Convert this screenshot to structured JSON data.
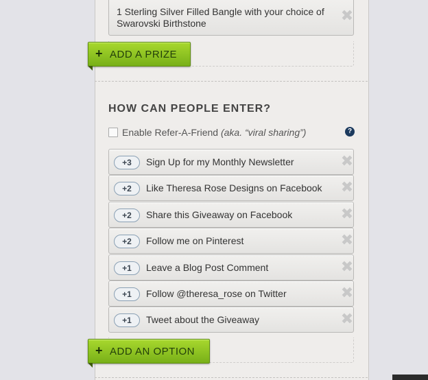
{
  "prize": {
    "text": "1 Sterling Silver Filled Bangle with your choice of Swarovski Birthstone",
    "remove_glyph": "✖"
  },
  "add_prize_button": {
    "plus": "+",
    "label": "Add a Prize"
  },
  "entry_section": {
    "heading": "How can people enter?",
    "refer_label": "Enable Refer-A-Friend",
    "refer_note": "(aka. “viral sharing”)",
    "help_glyph": "?"
  },
  "options": [
    {
      "points": "+3",
      "label": "Sign Up for my Monthly Newsletter",
      "remove_glyph": "✖"
    },
    {
      "points": "+2",
      "label": "Like Theresa Rose Designs on Facebook",
      "remove_glyph": "✖"
    },
    {
      "points": "+2",
      "label": "Share this Giveaway on Facebook",
      "remove_glyph": "✖"
    },
    {
      "points": "+2",
      "label": "Follow me on Pinterest",
      "remove_glyph": "✖"
    },
    {
      "points": "+1",
      "label": "Leave a Blog Post Comment",
      "remove_glyph": "✖"
    },
    {
      "points": "+1",
      "label": "Follow @theresa_rose on Twitter",
      "remove_glyph": "✖"
    },
    {
      "points": "+1",
      "label": "Tweet about the Giveaway",
      "remove_glyph": "✖"
    }
  ],
  "add_option_button": {
    "plus": "+",
    "label": "Add an Option"
  },
  "colors": {
    "button_green": "#8cc424",
    "help_icon": "#1c3a5e",
    "panel": "#efedeb",
    "background": "#e3e3e8"
  }
}
